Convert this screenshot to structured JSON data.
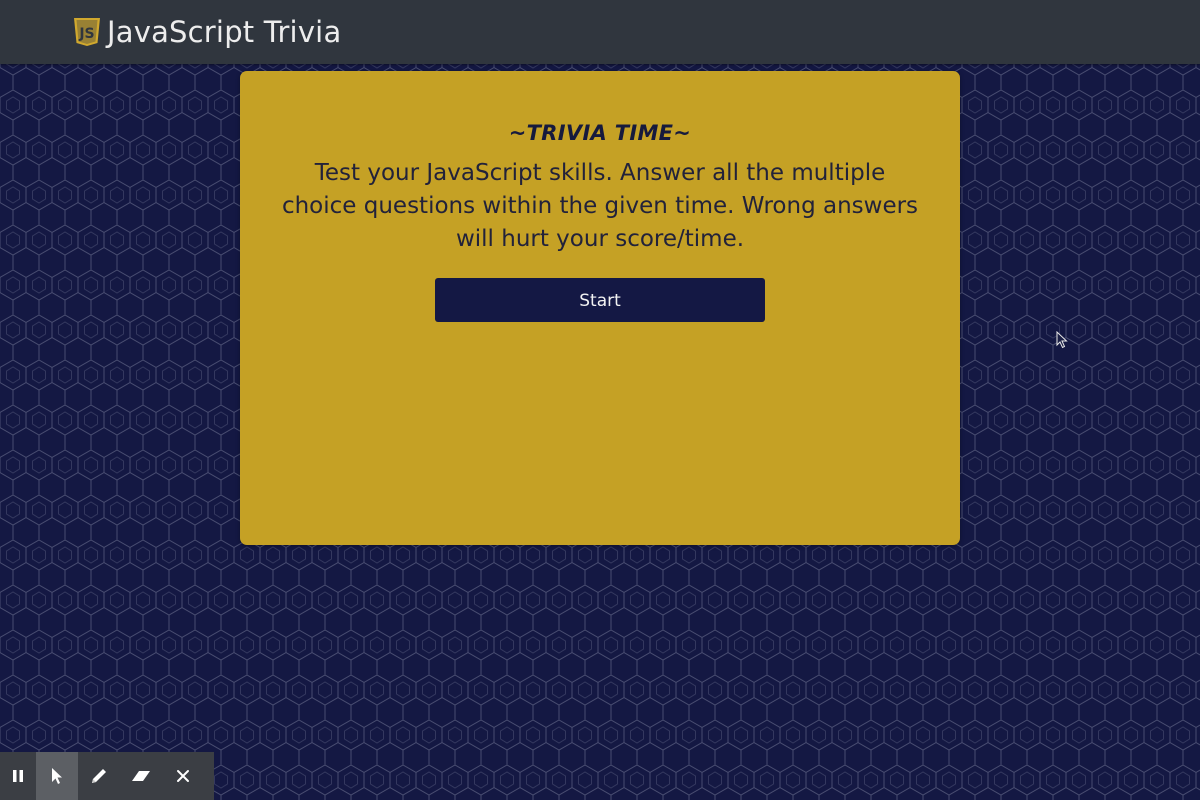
{
  "app": {
    "title": "JavaScript Trivia",
    "logo_icon": "javascript-shield-icon"
  },
  "card": {
    "heading": "~TRIVIA TIME~",
    "description": "Test your JavaScript skills. Answer all the multiple choice questions within the given time. Wrong answers will hurt your score/time.",
    "start_label": "Start"
  },
  "colors": {
    "background": "#141843",
    "topbar": "#30363e",
    "card": "#c5a125",
    "button": "#141844"
  },
  "toolbar": {
    "items": [
      "pause-icon",
      "pointer-icon",
      "pen-icon",
      "eraser-icon",
      "close-icon"
    ],
    "active": "pointer-icon"
  }
}
